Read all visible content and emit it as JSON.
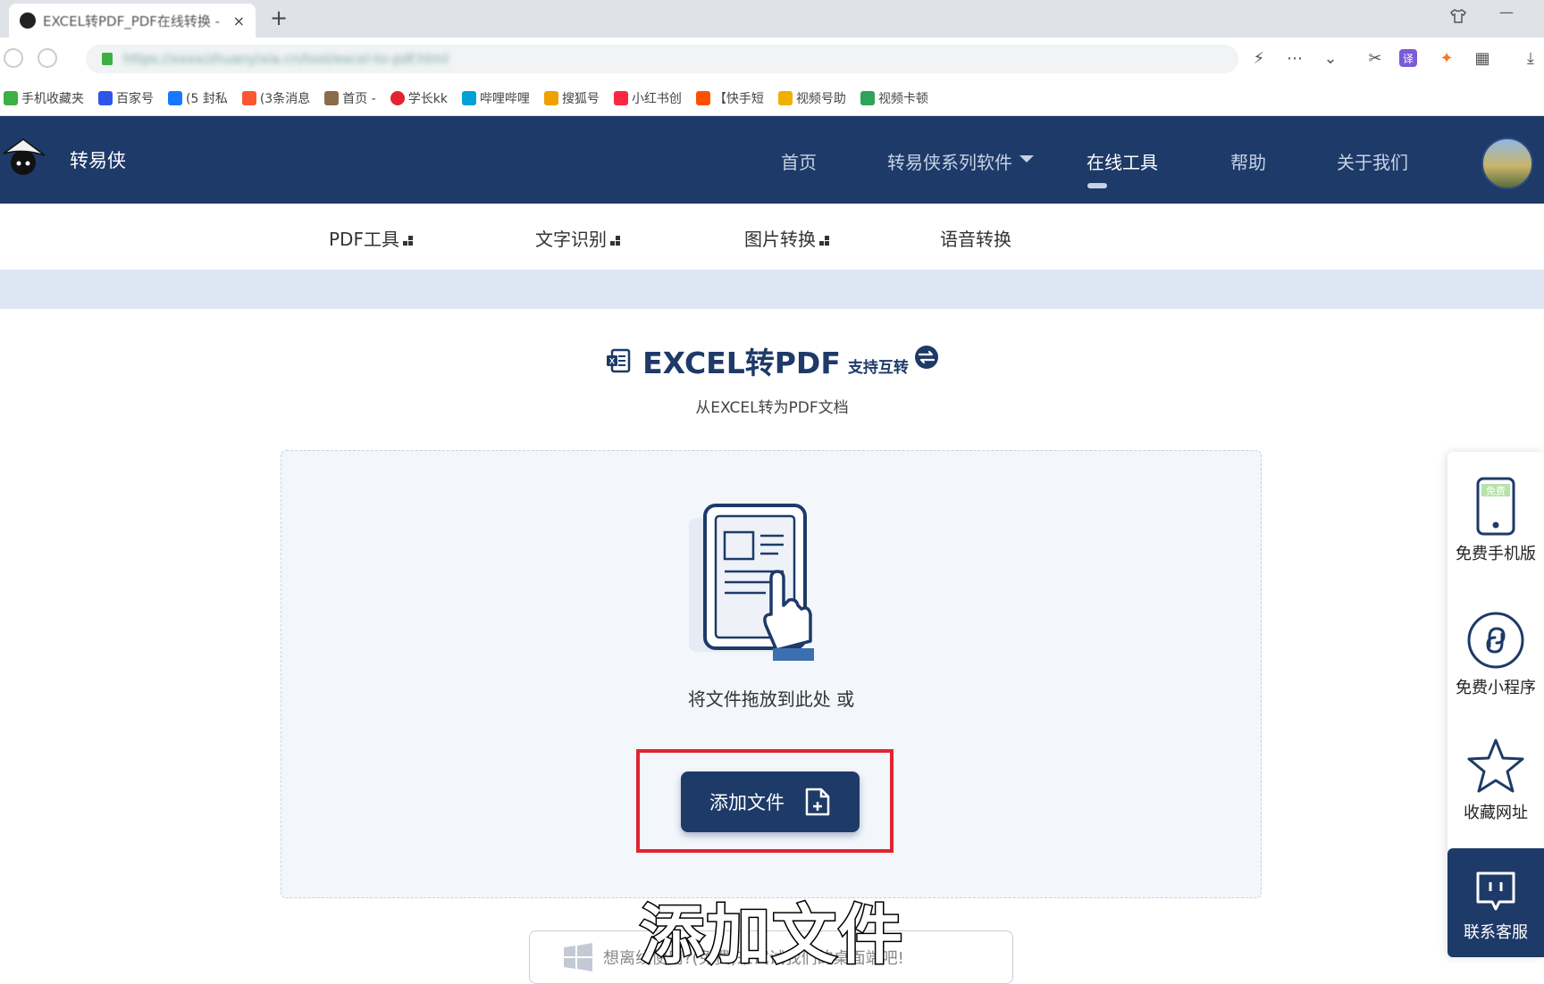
{
  "browser": {
    "tab_title": "EXCEL转PDF_PDF在线转换 -",
    "tab_close": "×",
    "new_tab": "+",
    "url": "https://xxxx/zhuanyixia.cn/tool/excel-to-pdf.html",
    "bookmarks": [
      {
        "label": "手机收藏夹",
        "icon": "phone-bookmark-icon",
        "color": "#3cb043"
      },
      {
        "label": "百家号",
        "icon": "paw-icon",
        "color": "#2f54eb"
      },
      {
        "label": "(5 封私",
        "icon": "zhihu-icon",
        "color": "#1677ff"
      },
      {
        "label": "(3条消息",
        "icon": "csdn-icon",
        "color": "#fc5531"
      },
      {
        "label": "首页 -",
        "icon": "book-icon",
        "color": "#8b6b4a"
      },
      {
        "label": "学长kk",
        "icon": "play-icon",
        "color": "#e02530"
      },
      {
        "label": "哔哩哔哩",
        "icon": "bilibili-icon",
        "color": "#00a1d6"
      },
      {
        "label": "搜狐号",
        "icon": "sohu-icon",
        "color": "#f0a000"
      },
      {
        "label": "小红书创",
        "icon": "xiaohongshu-icon",
        "color": "#ff2442"
      },
      {
        "label": "【快手短",
        "icon": "kuaishou-icon",
        "color": "#ff5000"
      },
      {
        "label": "视频号助",
        "icon": "channels-icon",
        "color": "#f0b000"
      },
      {
        "label": "视频卡顿",
        "icon": "crop-icon",
        "color": "#2fa35a"
      }
    ]
  },
  "site": {
    "brand": "转易侠",
    "nav": [
      "首页",
      "转易侠系列软件",
      "在线工具",
      "帮助",
      "关于我们"
    ],
    "active_nav": "在线工具",
    "subnav": [
      "PDF工具",
      "文字识别",
      "图片转换",
      "语音转换"
    ]
  },
  "main": {
    "title": "EXCEL转PDF",
    "title_badge": "支持互转",
    "subtitle": "从EXCEL转为PDF文档",
    "drop_text": "将文件拖放到此处 或",
    "add_button": "添加文件",
    "windows_banner": "想离线使用?(免费)来试试我们的桌面端吧!"
  },
  "sidebar": {
    "items": [
      "免费手机版",
      "免费小程序",
      "收藏网址"
    ],
    "phone_badge": "免费",
    "contact": "联系客服"
  },
  "caption": "添加文件",
  "colors": {
    "brand_navy": "#1e3a68",
    "highlight_red": "#e02530",
    "dropzone_bg": "#f3f6fb"
  }
}
